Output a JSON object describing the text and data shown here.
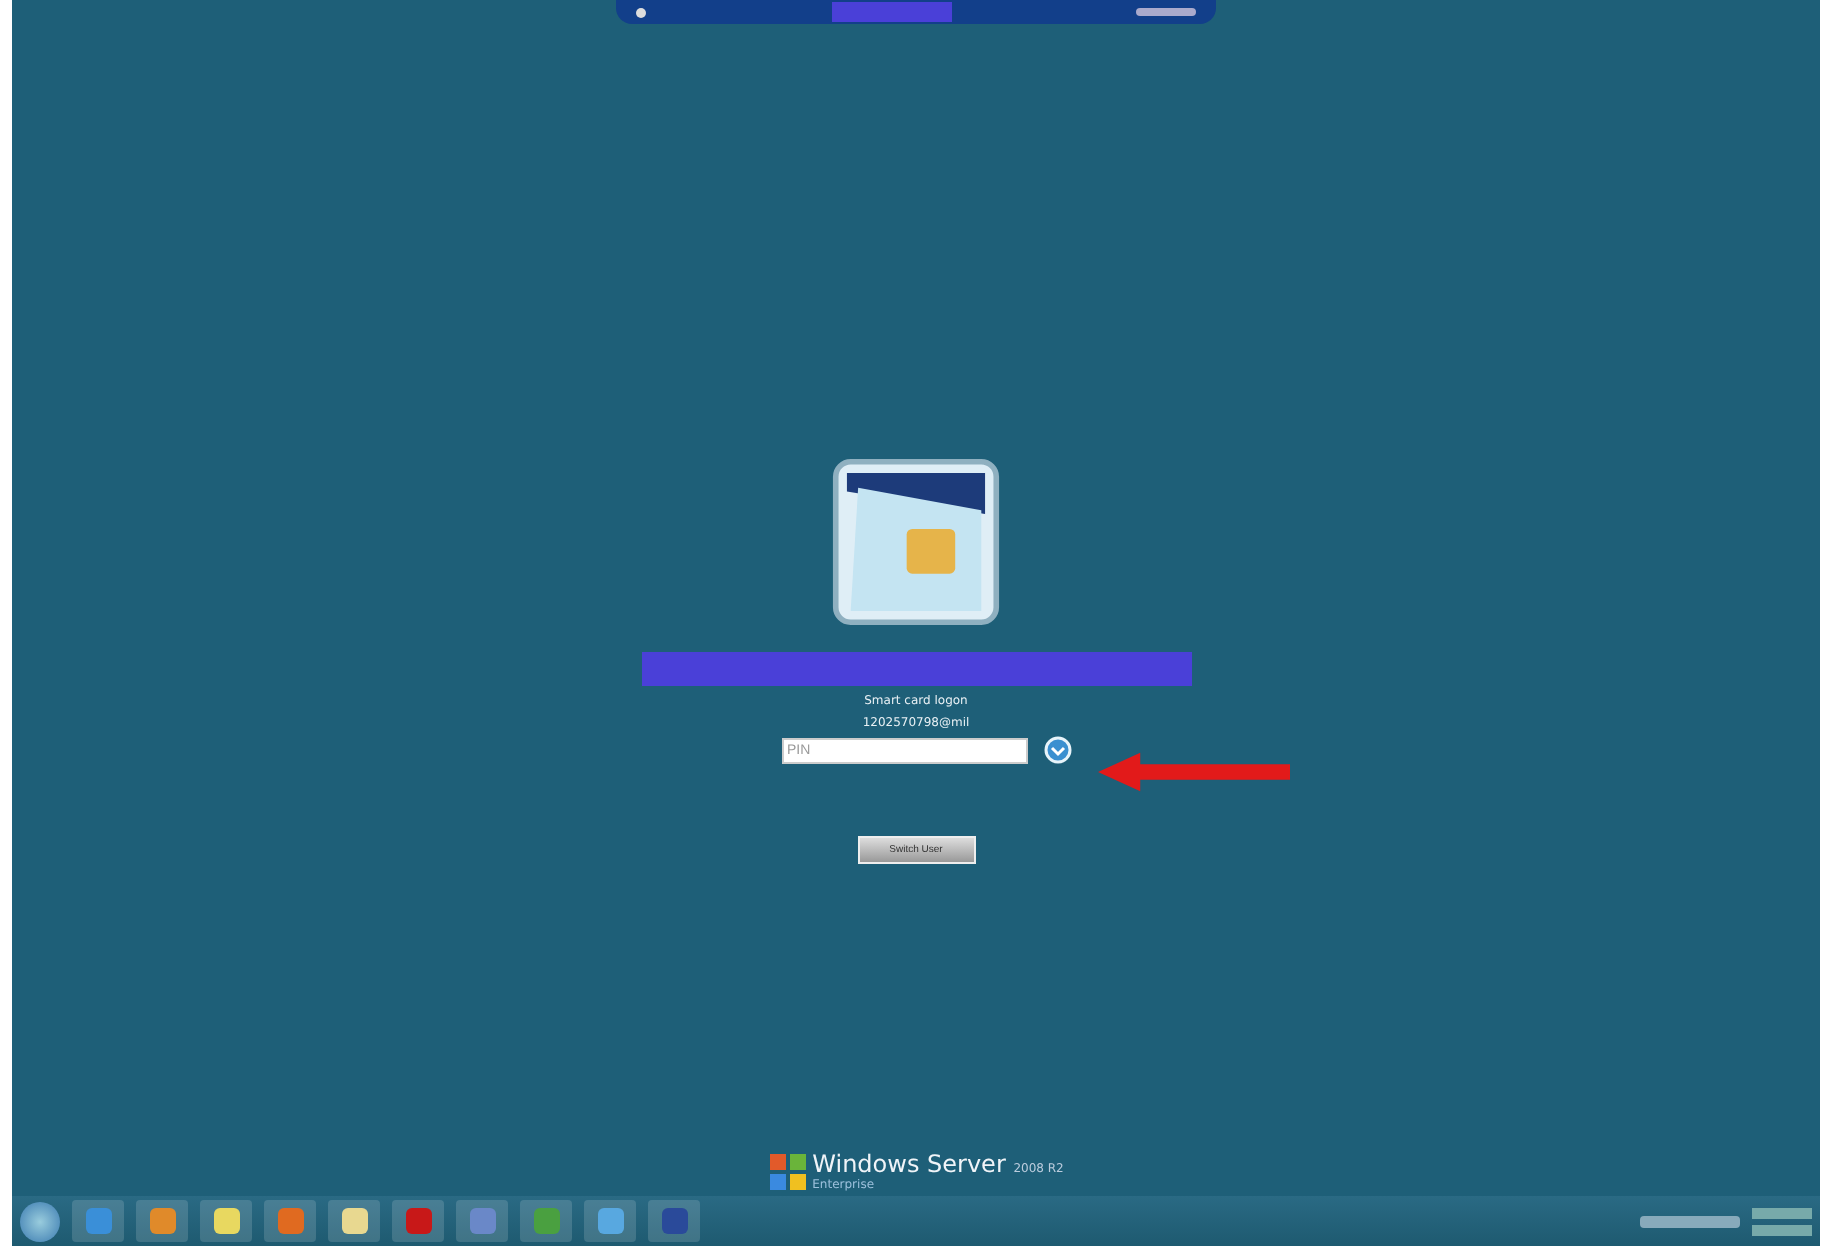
{
  "logon": {
    "title": "Smart card logon",
    "account": "1202570798@mil",
    "pin_field": {
      "placeholder": "PIN"
    },
    "button": "Switch User"
  },
  "branding": {
    "product": "Windows Server",
    "version": "2008 R2",
    "edition": "Enterprise"
  },
  "taskbar": {
    "pinned": [
      {
        "kind": "ie"
      },
      {
        "kind": "media"
      },
      {
        "kind": "folder-yellow"
      },
      {
        "kind": "firefox"
      },
      {
        "kind": "explorer"
      },
      {
        "kind": "pdf"
      },
      {
        "kind": "doc"
      },
      {
        "kind": "green"
      },
      {
        "kind": "monitor"
      },
      {
        "kind": "user"
      }
    ]
  }
}
